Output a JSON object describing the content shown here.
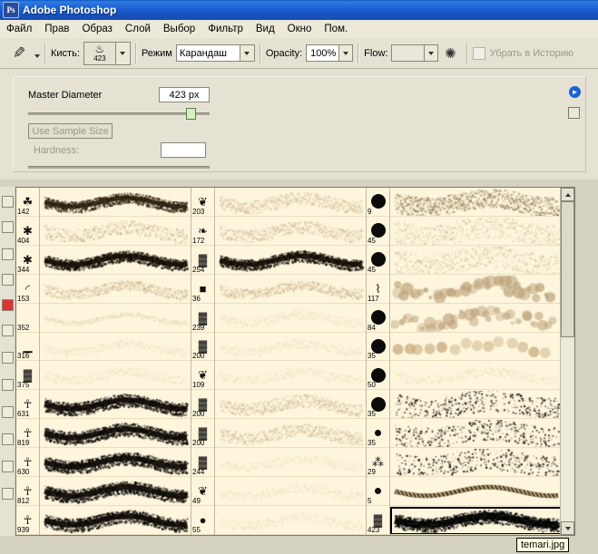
{
  "window": {
    "title": "Adobe Photoshop",
    "app_icon": "photoshop-icon"
  },
  "menubar": {
    "items": [
      {
        "label": "Файл"
      },
      {
        "label": "Прав"
      },
      {
        "label": "Образ"
      },
      {
        "label": "Слой"
      },
      {
        "label": "Выбор"
      },
      {
        "label": "Фильтр"
      },
      {
        "label": "Вид"
      },
      {
        "label": "Окно"
      },
      {
        "label": "Пом."
      }
    ]
  },
  "options_bar": {
    "tool_icon": "pencil-tool-icon",
    "tool_dropdown_icon": "chevron-down-icon",
    "brush_label": "Кисть:",
    "brush_preview_size": "423",
    "brush_dropdown_icon": "chevron-down-icon",
    "mode_label": "Режим",
    "mode_value": "Карандаш",
    "opacity_label": "Opacity:",
    "opacity_value": "100%",
    "flow_label": "Flow:",
    "flow_value": "",
    "airbrush_icon": "airbrush-icon",
    "erase_history_label": "Убрать в Историю",
    "erase_history_checked": false
  },
  "brush_panel": {
    "master_diameter_label": "Master Diameter",
    "master_diameter_value": "423 px",
    "use_sample_size_label": "Use Sample Size",
    "hardness_label": "Hardness:",
    "hardness_value": "",
    "panel_menu_icon": "panel-menu-icon",
    "panel_corner_icon": "panel-resize-icon"
  },
  "brush_list": {
    "scroll_up_icon": "scroll-up-arrow",
    "scroll_down_icon": "scroll-down-arrow",
    "columns": [
      {
        "type": "tip",
        "tips": [
          {
            "num": "142",
            "glyph": "grass"
          },
          {
            "num": "404",
            "glyph": "star"
          },
          {
            "num": "344",
            "glyph": "star"
          },
          {
            "num": "153",
            "glyph": "arc"
          },
          {
            "num": "352",
            "glyph": "blank"
          },
          {
            "num": "316",
            "glyph": "bar"
          },
          {
            "num": "375",
            "glyph": "blob"
          },
          {
            "num": "631",
            "glyph": "figure"
          },
          {
            "num": "819",
            "glyph": "figure"
          },
          {
            "num": "630",
            "glyph": "figure"
          },
          {
            "num": "812",
            "glyph": "figure"
          },
          {
            "num": "939",
            "glyph": "figure"
          }
        ]
      },
      {
        "type": "stroke",
        "strokes": [
          "rough-dark",
          "fuzzy-light",
          "dense-dark",
          "wave-light",
          "pale-line",
          "faint-dots",
          "soft-fade",
          "heavy-dark",
          "heavy-dark",
          "heavy-dark",
          "heavy-dark",
          "heavy-dark"
        ]
      },
      {
        "type": "tip",
        "tips": [
          {
            "num": "203",
            "glyph": "sprig"
          },
          {
            "num": "172",
            "glyph": "leaf"
          },
          {
            "num": "254",
            "glyph": "blob"
          },
          {
            "num": "36",
            "glyph": "square"
          },
          {
            "num": "239",
            "glyph": "blob"
          },
          {
            "num": "200",
            "glyph": "blob"
          },
          {
            "num": "109",
            "glyph": "sprig"
          },
          {
            "num": "200",
            "glyph": "blob"
          },
          {
            "num": "200",
            "glyph": "blob"
          },
          {
            "num": "244",
            "glyph": "blob"
          },
          {
            "num": "49",
            "glyph": "sprig"
          },
          {
            "num": "55",
            "glyph": "round"
          }
        ]
      },
      {
        "type": "stroke",
        "strokes": [
          "soft-tan",
          "soft-tan",
          "dense-dark",
          "wave-light",
          "pale-wave",
          "pale-wave",
          "pale-wave",
          "soft-tan",
          "soft-tan",
          "pale-wave",
          "pale-wave",
          "pale-wave"
        ]
      },
      {
        "type": "tip",
        "tips": [
          {
            "num": "9",
            "glyph": "dot-lg"
          },
          {
            "num": "45",
            "glyph": "dot-lg"
          },
          {
            "num": "45",
            "glyph": "dot-lg"
          },
          {
            "num": "117",
            "glyph": "scratch"
          },
          {
            "num": "84",
            "glyph": "dot-lg"
          },
          {
            "num": "35",
            "glyph": "dot-lg"
          },
          {
            "num": "50",
            "glyph": "dot-lg"
          },
          {
            "num": "35",
            "glyph": "dot-lg"
          },
          {
            "num": "35",
            "glyph": "dot-sm"
          },
          {
            "num": "29",
            "glyph": "spatter"
          },
          {
            "num": "5",
            "glyph": "dot-sm"
          },
          {
            "num": "423",
            "glyph": "dark-blob"
          }
        ]
      },
      {
        "type": "stroke",
        "strokes": [
          "cloud-dark",
          "cloud-soft",
          "cloud-soft",
          "bubbles",
          "bubbles",
          "coins",
          "pale-wave",
          "spatter-dark",
          "spatter-dark",
          "spatter-dark",
          "ribbon",
          "thick-black"
        ]
      }
    ],
    "selected_cell": {
      "column": 5,
      "row": 11,
      "num": "423"
    }
  },
  "tooltip": {
    "text": "temari.jpg"
  },
  "colors": {
    "titlebar_blue": "#1b62d4",
    "panel_bg": "#e5e2d4",
    "brush_list_bg": "#fdf6dd",
    "menu_bg": "#ece9d8",
    "tooltip_bg": "#ffffe1"
  }
}
